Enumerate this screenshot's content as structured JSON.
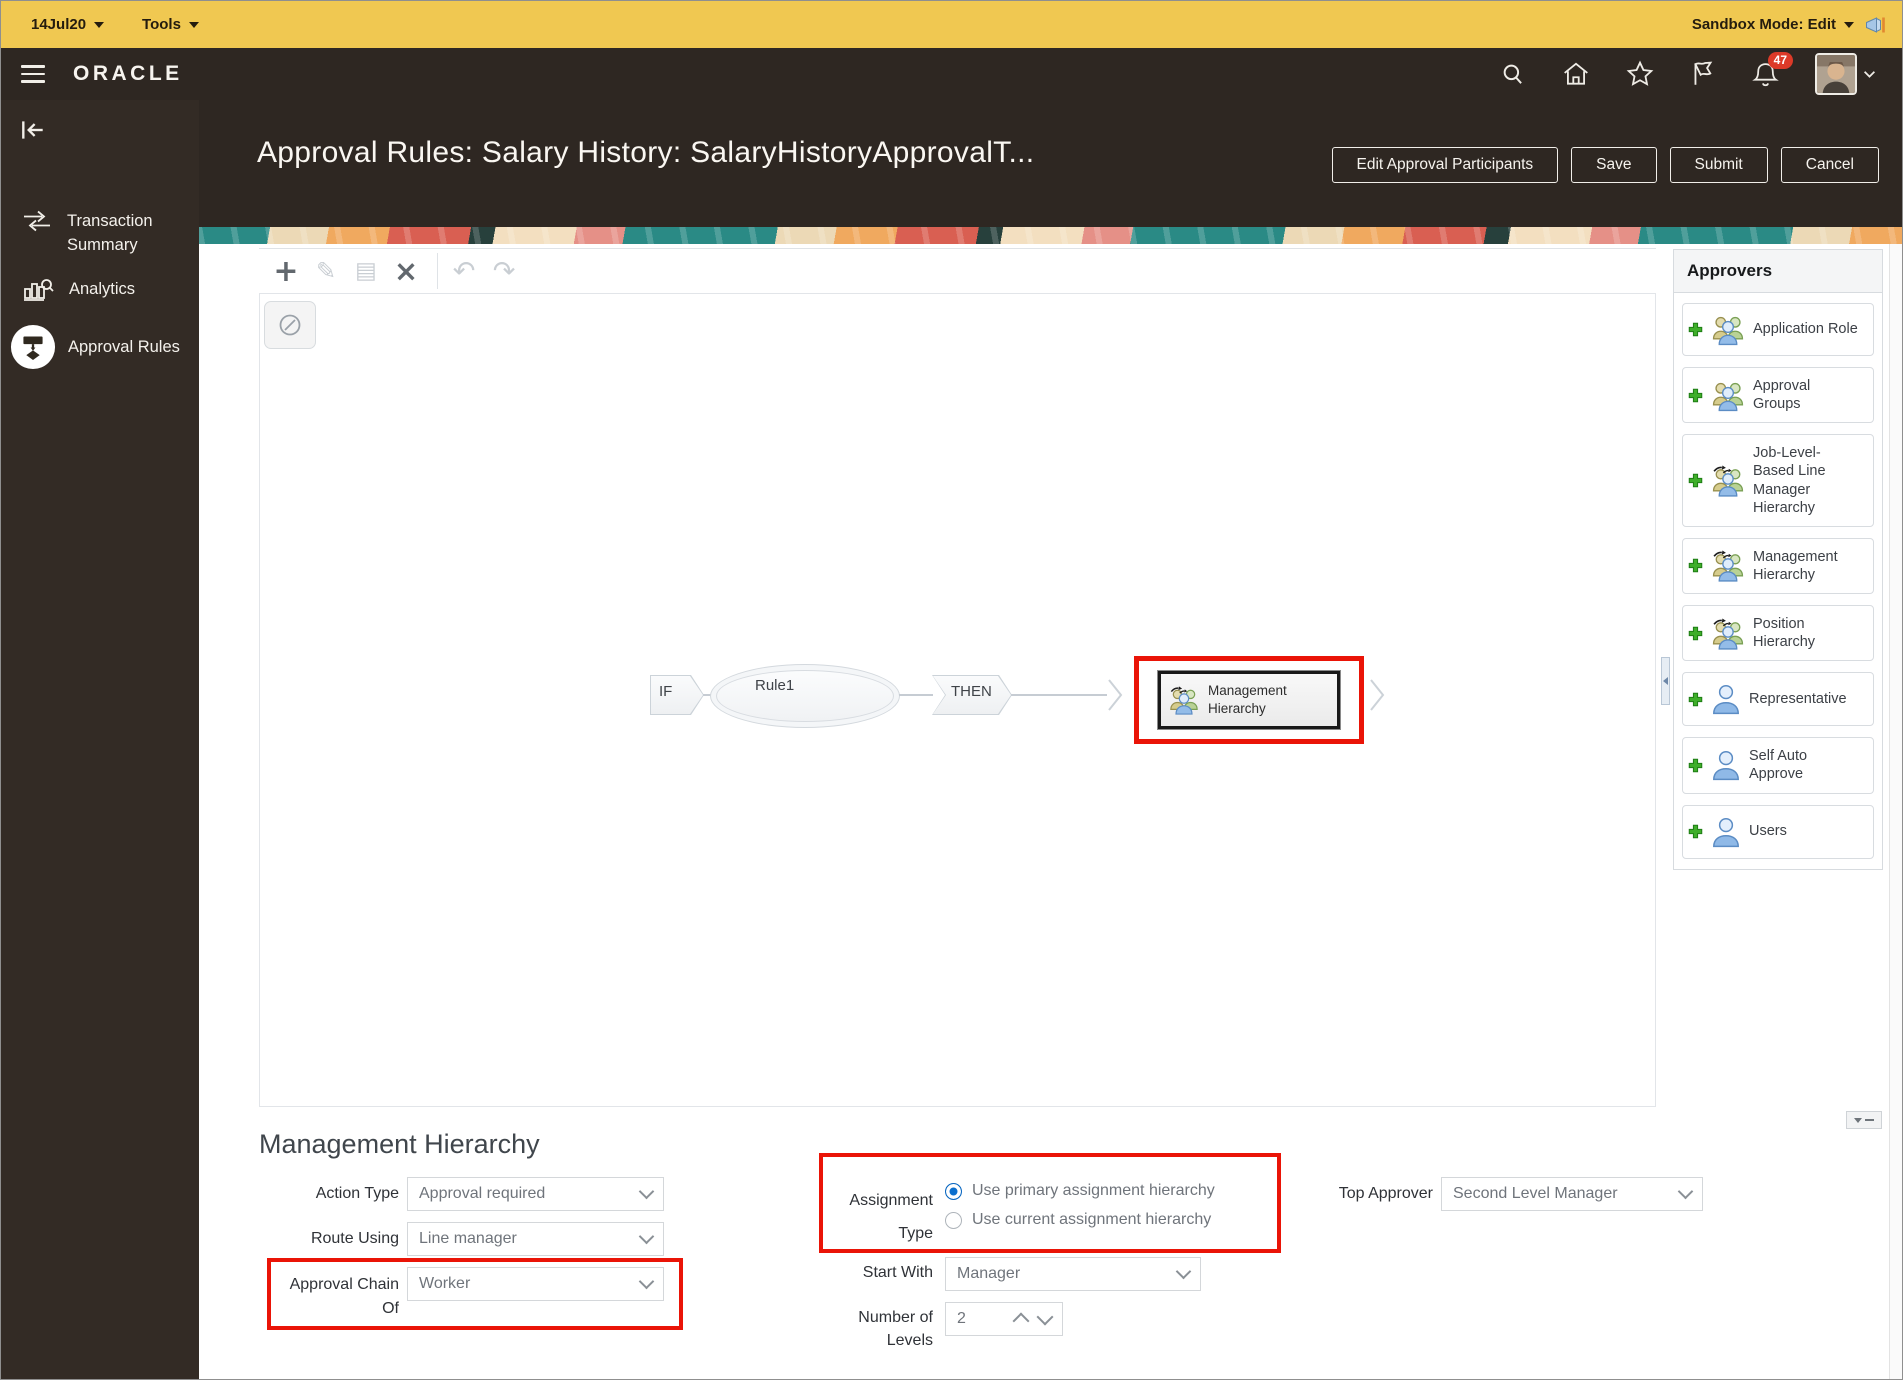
{
  "sandbox_bar": {
    "date_label": "14Jul20",
    "tools_label": "Tools",
    "mode_label": "Sandbox Mode: Edit"
  },
  "header": {
    "logo": "ORACLE",
    "notification_count": "47"
  },
  "page": {
    "title": "Approval Rules: Salary History: SalaryHistoryApprovalT...",
    "buttons": {
      "edit_participants": "Edit Approval Participants",
      "save": "Save",
      "submit": "Submit",
      "cancel": "Cancel"
    }
  },
  "sidebar": {
    "items": [
      {
        "label": "Transaction Summary",
        "icon": "transfer-arrows-icon"
      },
      {
        "label": "Analytics",
        "icon": "analytics-icon"
      },
      {
        "label": "Approval Rules",
        "icon": "approval-rules-icon"
      }
    ]
  },
  "toolbar_icons": {
    "add": "+",
    "edit": "✎",
    "copy": "▤",
    "delete": "×",
    "undo": "↶",
    "redo": "↷"
  },
  "flow": {
    "if_label": "IF",
    "rule_label": "Rule1",
    "then_label": "THEN",
    "node_label": "Management Hierarchy"
  },
  "approvers": {
    "title": "Approvers",
    "items": [
      {
        "label": "Application Role",
        "icon": "group-icon"
      },
      {
        "label": "Approval Groups",
        "icon": "group-icon"
      },
      {
        "label": "Job-Level-Based Line Manager Hierarchy",
        "icon": "hierarchy-icon"
      },
      {
        "label": "Management Hierarchy",
        "icon": "hierarchy-icon"
      },
      {
        "label": "Position Hierarchy",
        "icon": "hierarchy-icon"
      },
      {
        "label": "Representative",
        "icon": "person-icon"
      },
      {
        "label": "Self Auto Approve",
        "icon": "person-icon"
      },
      {
        "label": "Users",
        "icon": "person-icon"
      }
    ]
  },
  "form": {
    "section_title": "Management Hierarchy",
    "action_type": {
      "label": "Action Type",
      "value": "Approval required"
    },
    "route_using": {
      "label": "Route Using",
      "value": "Line manager"
    },
    "approval_chain_of": {
      "label": "Approval Chain Of",
      "value": "Worker"
    },
    "assignment_type": {
      "label": "Assignment Type",
      "options": [
        "Use primary assignment hierarchy",
        "Use current assignment hierarchy"
      ],
      "selected": "Use primary assignment hierarchy"
    },
    "start_with": {
      "label": "Start With",
      "value": "Manager"
    },
    "number_of_levels": {
      "label": "Number of Levels",
      "value": "2"
    },
    "top_approver": {
      "label": "Top Approver",
      "value": "Second Level Manager"
    }
  },
  "colors": {
    "sandbox_yellow": "#F0C851",
    "header_dark": "#2E2722",
    "highlight_red": "#EA1407",
    "badge_red": "#DC3A28",
    "radio_blue": "#0B6FCE",
    "plus_green": "#3FAE2A"
  }
}
